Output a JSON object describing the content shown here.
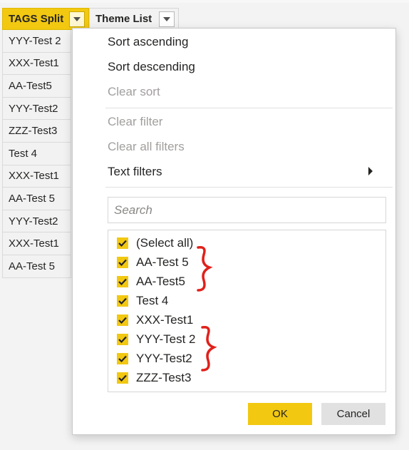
{
  "columns": [
    {
      "label": "TAGS Split",
      "active": true
    },
    {
      "label": "Theme List",
      "active": false
    }
  ],
  "cells": [
    "YYY-Test 2",
    "XXX-Test1",
    "AA-Test5",
    "YYY-Test2",
    "ZZZ-Test3",
    "Test 4",
    "XXX-Test1",
    "AA-Test 5",
    "YYY-Test2",
    "XXX-Test1",
    "AA-Test 5"
  ],
  "menu": {
    "sort_ascending": "Sort ascending",
    "sort_descending": "Sort descending",
    "clear_sort": "Clear sort",
    "clear_filter": "Clear filter",
    "clear_all_filters": "Clear all filters",
    "text_filters": "Text filters"
  },
  "search": {
    "placeholder": "Search"
  },
  "options": [
    {
      "label": "(Select all)",
      "checked": true
    },
    {
      "label": "AA-Test 5",
      "checked": true
    },
    {
      "label": "AA-Test5",
      "checked": true
    },
    {
      "label": "Test 4",
      "checked": true
    },
    {
      "label": "XXX-Test1",
      "checked": true
    },
    {
      "label": "YYY-Test 2",
      "checked": true
    },
    {
      "label": "YYY-Test2",
      "checked": true
    },
    {
      "label": "ZZZ-Test3",
      "checked": true
    }
  ],
  "buttons": {
    "ok": "OK",
    "cancel": "Cancel"
  },
  "colors": {
    "accent": "#f2c811",
    "annotation": "#e0201b",
    "disabled_text": "#a19f9d"
  },
  "icons": {
    "dropdown": "chevron-down-icon",
    "submenu": "chevron-right-icon",
    "check": "checkmark-icon"
  }
}
